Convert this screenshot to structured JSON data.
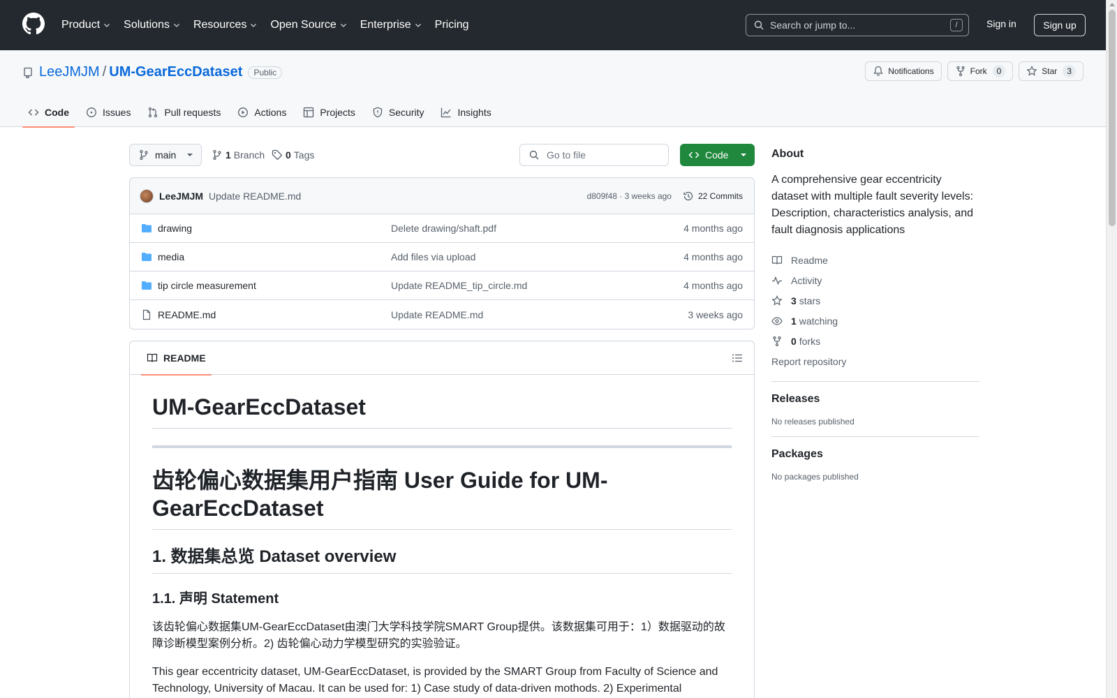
{
  "header": {
    "nav": [
      {
        "label": "Product",
        "dropdown": true
      },
      {
        "label": "Solutions",
        "dropdown": true
      },
      {
        "label": "Resources",
        "dropdown": true
      },
      {
        "label": "Open Source",
        "dropdown": true
      },
      {
        "label": "Enterprise",
        "dropdown": true
      },
      {
        "label": "Pricing",
        "dropdown": false
      }
    ],
    "search_placeholder": "Search or jump to...",
    "search_shortcut": "/",
    "sign_in": "Sign in",
    "sign_up": "Sign up"
  },
  "repo": {
    "owner": "LeeJMJM",
    "separator": "/",
    "name": "UM-GearEccDataset",
    "visibility": "Public",
    "notifications_label": "Notifications",
    "fork_label": "Fork",
    "fork_count": "0",
    "star_label": "Star",
    "star_count": "3",
    "tabs": [
      {
        "label": "Code",
        "icon": "code-icon",
        "active": true
      },
      {
        "label": "Issues",
        "icon": "issue-icon",
        "active": false
      },
      {
        "label": "Pull requests",
        "icon": "pull-request-icon",
        "active": false
      },
      {
        "label": "Actions",
        "icon": "play-icon",
        "active": false
      },
      {
        "label": "Projects",
        "icon": "table-icon",
        "active": false
      },
      {
        "label": "Security",
        "icon": "shield-icon",
        "active": false
      },
      {
        "label": "Insights",
        "icon": "graph-icon",
        "active": false
      }
    ]
  },
  "toolbar": {
    "branch": "main",
    "branch_count": "1",
    "branch_label": "Branch",
    "tag_count": "0",
    "tag_label": "Tags",
    "go_to_file": "Go to file",
    "code_button": "Code"
  },
  "latest_commit": {
    "author": "LeeJMJM",
    "message": "Update README.md",
    "hash_time": "d809f48 · 3 weeks ago",
    "commits_label": "22 Commits"
  },
  "files": [
    {
      "type": "folder",
      "name": "drawing",
      "commit": "Delete drawing/shaft.pdf",
      "age": "4 months ago"
    },
    {
      "type": "folder",
      "name": "media",
      "commit": "Add files via upload",
      "age": "4 months ago"
    },
    {
      "type": "folder",
      "name": "tip circle measurement",
      "commit": "Update README_tip_circle.md",
      "age": "4 months ago"
    },
    {
      "type": "file",
      "name": "README.md",
      "commit": "Update README.md",
      "age": "3 weeks ago"
    }
  ],
  "readme": {
    "tab_label": "README",
    "h1": "UM-GearEccDataset",
    "h1b": "齿轮偏心数据集用户指南 User Guide for UM-GearEccDataset",
    "h2": "1. 数据集总览 Dataset overview",
    "h3": "1.1. 声明 Statement",
    "p1": "该齿轮偏心数据集UM-GearEccDataset由澳门大学科技学院SMART Group提供。该数据集可用于：1）数据驱动的故障诊断模型案例分析。2) 齿轮偏心动力学模型研究的实验验证。",
    "p2": "This gear eccentricity dataset, UM-GearEccDataset, is provided by the SMART Group from Faculty of Science and Technology, University of Macau. It can be used for: 1) Case study of data-driven mothods. 2) Experimental"
  },
  "about": {
    "heading": "About",
    "description": "A comprehensive gear eccentricity dataset with multiple fault severity levels: Description, characteristics analysis, and fault diagnosis applications",
    "readme": "Readme",
    "activity": "Activity",
    "stars_count": "3",
    "stars_label": "stars",
    "watching_count": "1",
    "watching_label": "watching",
    "forks_count": "0",
    "forks_label": "forks",
    "report": "Report repository"
  },
  "releases": {
    "heading": "Releases",
    "text": "No releases published"
  },
  "packages": {
    "heading": "Packages",
    "text": "No packages published"
  },
  "colors": {
    "header_bg": "#24292f",
    "link": "#0969da",
    "primary_green": "#1f883d",
    "active_tab_underline": "#fd8c73",
    "folder": "#54aeff"
  }
}
